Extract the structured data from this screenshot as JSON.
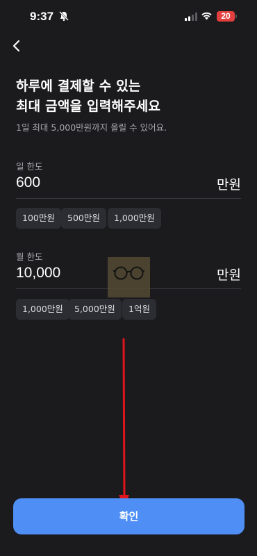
{
  "status_bar": {
    "time": "9:37",
    "battery": "20",
    "icons": [
      "bell-off-icon",
      "signal-icon",
      "wifi-icon",
      "battery-icon"
    ],
    "battery_color": "#e2403f"
  },
  "header": {
    "back_icon": "chevron-left-icon"
  },
  "title": {
    "line1": "하루에 결제할 수 있는",
    "line2": "최대 금액을 입력해주세요",
    "subtitle": "1일 최대 5,000만원까지 올릴 수 있어요."
  },
  "daily_limit": {
    "label": "일 한도",
    "value": "600",
    "unit": "만원",
    "chips": [
      "100만원",
      "500만원",
      "1,000만원"
    ]
  },
  "monthly_limit": {
    "label": "월 한도",
    "value": "10,000",
    "unit": "만원",
    "chips": [
      "1,000만원",
      "5,000만원",
      "1억원"
    ]
  },
  "confirm": {
    "label": "확인",
    "color": "#4f8ff5"
  },
  "annotation": {
    "arrow_color": "#e0141b"
  }
}
